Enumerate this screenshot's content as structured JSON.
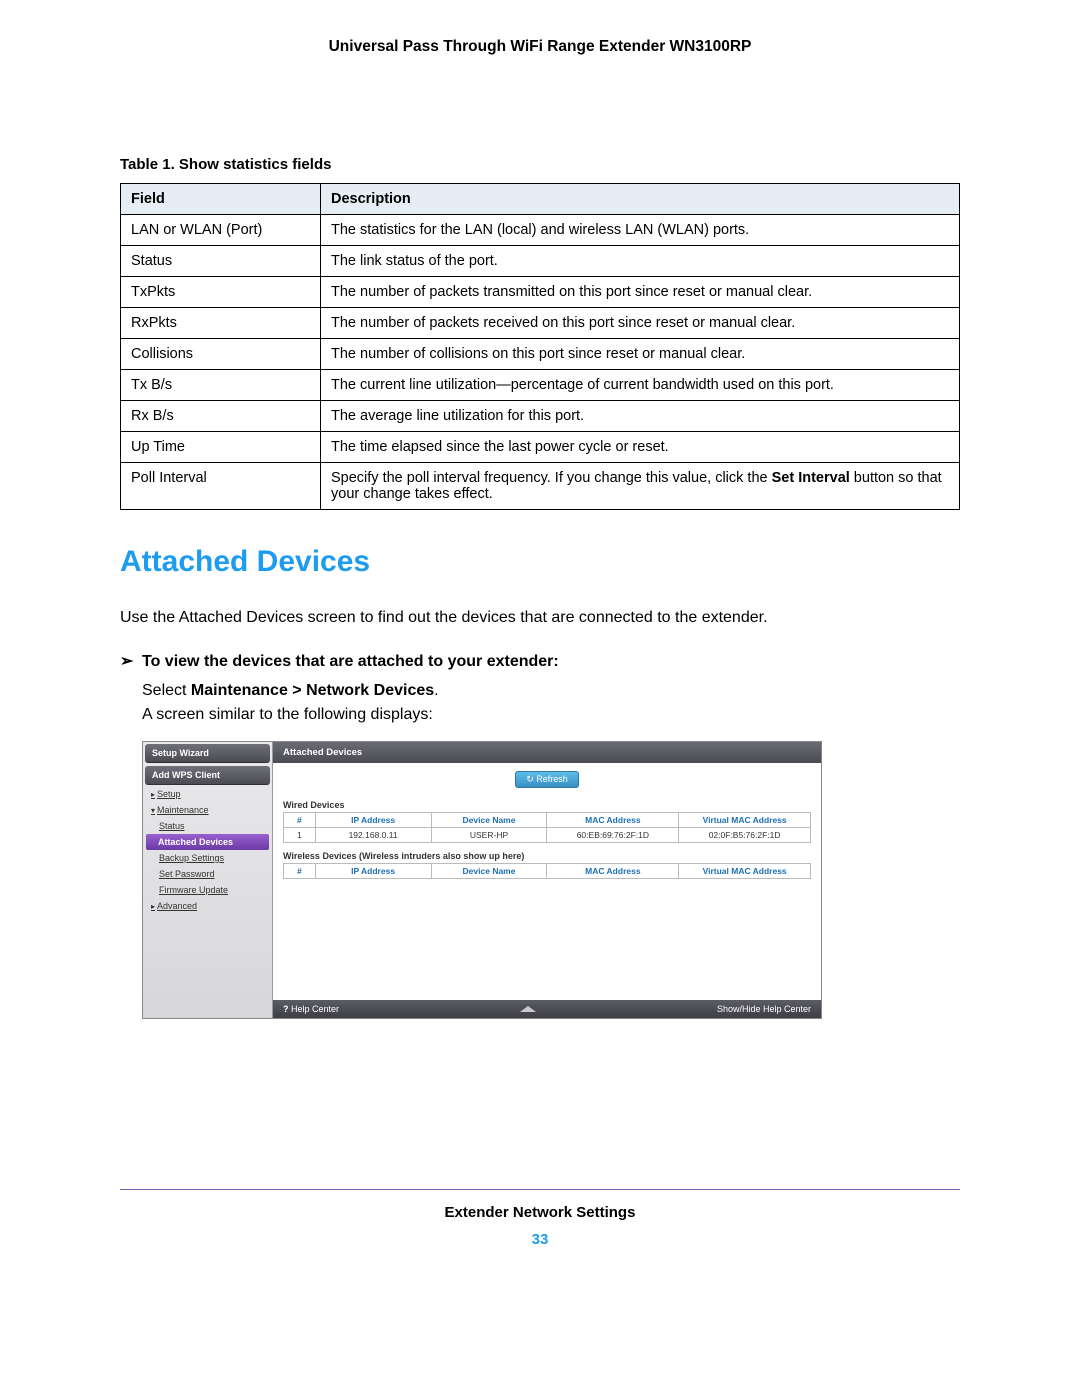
{
  "header": {
    "title": "Universal Pass Through WiFi Range Extender WN3100RP"
  },
  "table1": {
    "caption": "Table 1.  Show statistics fields",
    "headers": {
      "field": "Field",
      "description": "Description"
    },
    "rows": [
      {
        "field": "LAN or WLAN (Port)",
        "desc": "The statistics for the LAN (local) and wireless LAN (WLAN) ports."
      },
      {
        "field": "Status",
        "desc": "The link status of the port."
      },
      {
        "field": "TxPkts",
        "desc": "The number of packets transmitted on this port since reset or manual clear."
      },
      {
        "field": "RxPkts",
        "desc": "The number of packets received on this port since reset or manual clear."
      },
      {
        "field": "Collisions",
        "desc": "The number of collisions on this port since reset or manual clear."
      },
      {
        "field": "Tx B/s",
        "desc": "The current line utilization—percentage of current bandwidth used on this port."
      },
      {
        "field": "Rx B/s",
        "desc": "The average line utilization for this port."
      },
      {
        "field": "Up Time",
        "desc": "The time elapsed since the last power cycle or reset."
      }
    ],
    "pollRow": {
      "field": "Poll Interval",
      "desc_pre": "Specify the poll interval frequency. If you change this value, click the ",
      "desc_bold": "Set Interval",
      "desc_post": " button so that your change takes effect."
    }
  },
  "section": {
    "heading": "Attached Devices",
    "intro": "Use the Attached Devices screen to find out the devices that are connected to the extender.",
    "step_marker": "➢",
    "step_title": "To view the devices that are attached to your extender:",
    "step_select_pre": "Select ",
    "step_select_bold": "Maintenance > Network Devices",
    "step_select_post": ".",
    "step_after": "A screen similar to the following displays:"
  },
  "screenshot": {
    "sidebar": {
      "btn1": "Setup Wizard",
      "btn2": "Add WPS Client",
      "setup": "Setup",
      "maintenance": "Maintenance",
      "status": "Status",
      "attached": "Attached Devices",
      "backup": "Backup Settings",
      "setpw": "Set Password",
      "firmware": "Firmware Update",
      "advanced": "Advanced"
    },
    "main": {
      "title": "Attached Devices",
      "refresh": "Refresh",
      "wired_label": "Wired Devices",
      "wireless_label": "Wireless Devices (Wireless intruders also show up here)",
      "cols": {
        "num": "#",
        "ip": "IP Address",
        "name": "Device Name",
        "mac": "MAC Address",
        "vmac": "Virtual MAC Address"
      },
      "wired_rows": [
        {
          "num": "1",
          "ip": "192.168.0.11",
          "name": "USER-HP",
          "mac": "60:EB:69:76:2F:1D",
          "vmac": "02:0F:B5:76:2F:1D"
        }
      ]
    },
    "footer": {
      "help": "Help Center",
      "toggle": "Show/Hide Help Center"
    }
  },
  "footer": {
    "section": "Extender Network Settings",
    "page": "33"
  }
}
